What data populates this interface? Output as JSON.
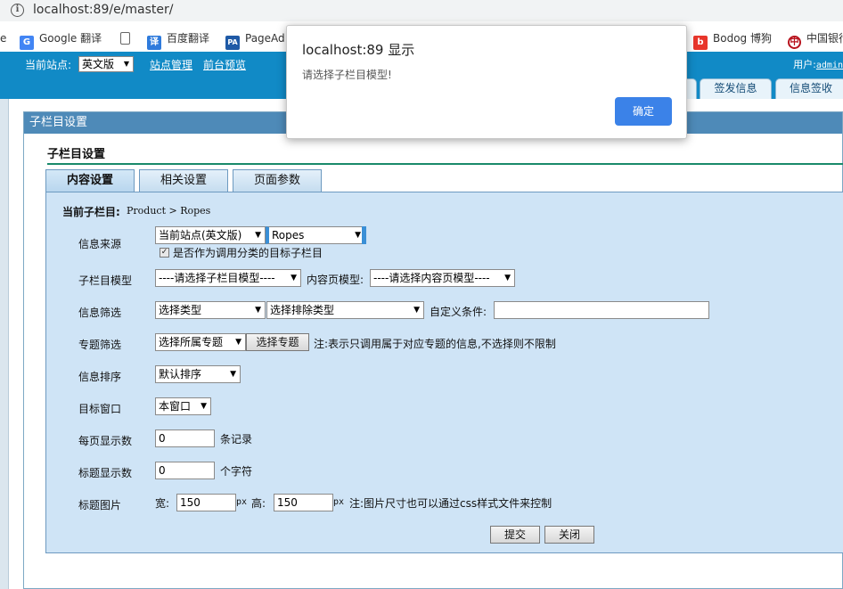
{
  "browser": {
    "url": "localhost:89/e/master/",
    "bookmarks": [
      {
        "label": "e",
        "icon": "",
        "color": "#ffffff"
      },
      {
        "label": "Google 翻译",
        "icon": "google-translate-icon",
        "color": "#4285f4"
      },
      {
        "label": "",
        "icon": "document-icon",
        "color": "#ffffff"
      },
      {
        "label": "百度翻译",
        "icon": "baidu-translate-icon",
        "color": "#2f7bdc"
      },
      {
        "label": "PageAd",
        "icon": "pagead-icon",
        "color": "#1f5aa6"
      },
      {
        "label": "Bodog 博狗",
        "icon": "bodog-icon",
        "color": "#e8352b"
      },
      {
        "label": "中国银行",
        "icon": "boc-icon",
        "color": "#b8121d"
      }
    ]
  },
  "header": {
    "station_label": "当前站点:",
    "station_value": "英文版",
    "links": [
      "站点管理",
      "前台预览"
    ],
    "user_label": "用户:",
    "user_name": "admin",
    "tabs": [
      "签发信息",
      "信息签收"
    ]
  },
  "panel": {
    "title": "子栏目设置",
    "section_title": "子栏目设置",
    "tabs": [
      "内容设置",
      "相关设置",
      "页面参数"
    ],
    "breadcrumb_label": "当前子栏目:",
    "breadcrumb_path": "Product > Ropes",
    "rows": {
      "source": {
        "label": "信息来源",
        "site_select": "当前站点(英文版)",
        "column_select": "Ropes",
        "checkbox_label": "是否作为调用分类的目标子栏目",
        "checked": true
      },
      "model": {
        "label": "子栏目模型",
        "model_select": "----请选择子栏目模型----",
        "content_label": "内容页模型:",
        "content_select": "----请选择内容页模型----"
      },
      "filter": {
        "label": "信息筛选",
        "type_select": "选择类型",
        "exclude_select": "选择排除类型",
        "custom_label": "自定义条件:",
        "custom_value": ""
      },
      "topic": {
        "label": "专题筛选",
        "topic_select": "选择所属专题",
        "topic_button": "选择专题",
        "note": "注:表示只调用属于对应专题的信息,不选择则不限制"
      },
      "sort": {
        "label": "信息排序",
        "select": "默认排序"
      },
      "target": {
        "label": "目标窗口",
        "select": "本窗口"
      },
      "per_page": {
        "label": "每页显示数",
        "value": "0",
        "unit": "条记录"
      },
      "title_len": {
        "label": "标题显示数",
        "value": "0",
        "unit": "个字符"
      },
      "title_img": {
        "label": "标题图片",
        "width_label": "宽:",
        "width_value": "150",
        "px1": "px",
        "height_label": "高:",
        "height_value": "150",
        "px2": "px",
        "note": "注:图片尺寸也可以通过css样式文件来控制"
      }
    },
    "submit_label": "提交",
    "close_label": "关闭"
  },
  "dialog": {
    "title": "localhost:89 显示",
    "message": "请选择子栏目模型!",
    "ok_label": "确定"
  }
}
